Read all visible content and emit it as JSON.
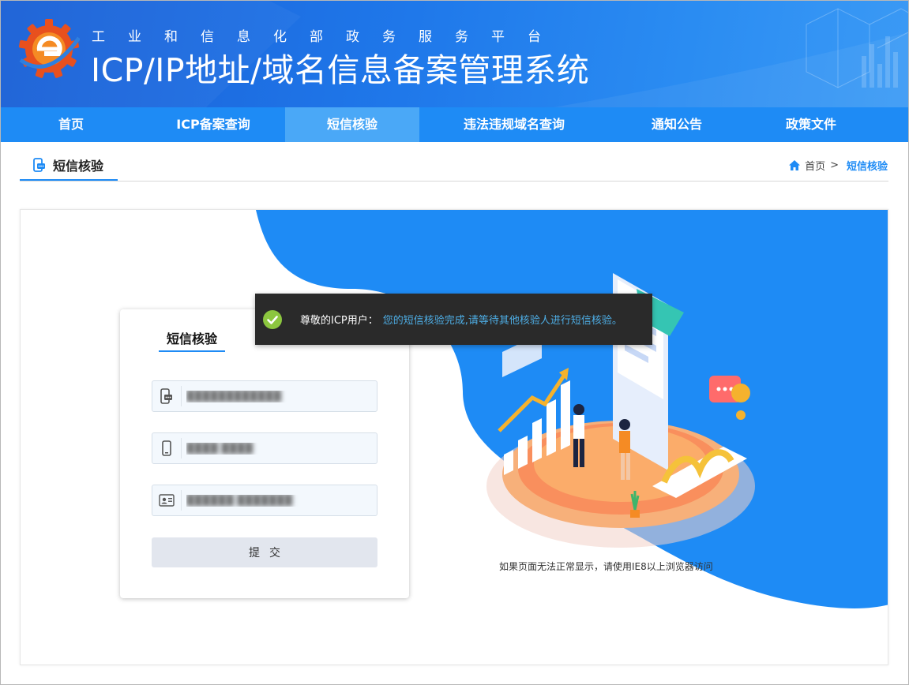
{
  "header": {
    "subtitle": "工业和信息化部政务服务平台",
    "title": "ICP/IP地址/域名信息备案管理系统",
    "logo": "miit-gear-logo"
  },
  "nav": {
    "items": [
      {
        "label": "首页",
        "active": false
      },
      {
        "label": "ICP备案查询",
        "active": false
      },
      {
        "label": "短信核验",
        "active": true
      },
      {
        "label": "违法违规域名查询",
        "active": false
      },
      {
        "label": "通知公告",
        "active": false
      },
      {
        "label": "政策文件",
        "active": false
      }
    ]
  },
  "page": {
    "tab_label": "短信核验",
    "tab_icon": "sms-phone-icon"
  },
  "breadcrumb": {
    "home": "首页",
    "separator": ">",
    "current": "短信核验"
  },
  "form": {
    "tab": "短信核验",
    "fields": [
      {
        "icon": "sms-code-icon",
        "value": "████████████"
      },
      {
        "icon": "mobile-phone-icon",
        "value": "████ ████"
      },
      {
        "icon": "id-card-icon",
        "value": "██████ ███████"
      }
    ],
    "submit": "提交"
  },
  "toast": {
    "icon": "check-circle-icon",
    "label": "尊敬的ICP用户：",
    "message": "您的短信核验完成,请等待其他核验人进行短信核验。"
  },
  "notice": "如果页面无法正常显示，请使用IE8以上浏览器访问",
  "colors": {
    "primary": "#1e8bf5",
    "nav_active": "#4aa8f7",
    "toast_bg": "#2a2a2a",
    "toast_msg": "#4eaee6",
    "success": "#8cc63f"
  }
}
